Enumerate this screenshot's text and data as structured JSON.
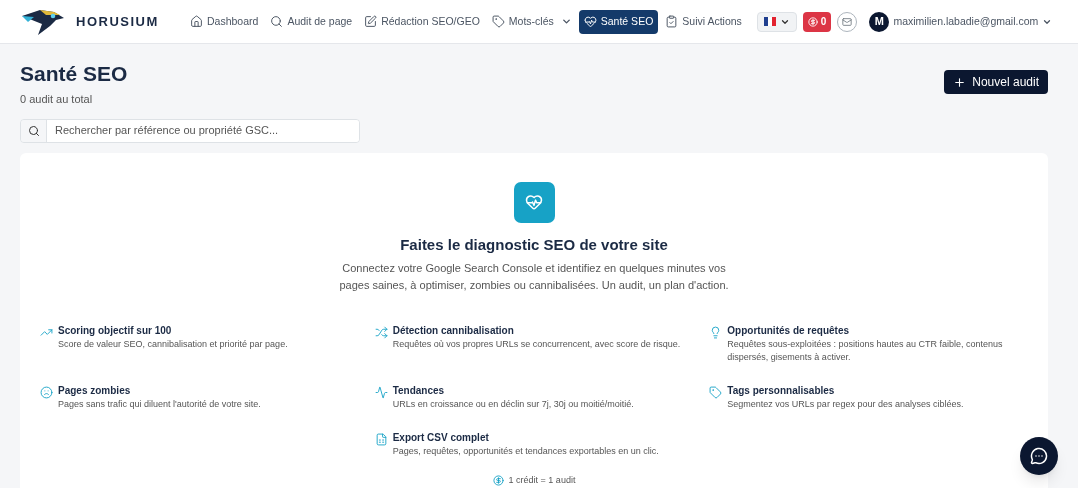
{
  "brand": {
    "name": "HORUSIUM"
  },
  "nav": [
    {
      "label": "Dashboard",
      "kind": "home",
      "selected": false,
      "dropdown": false
    },
    {
      "label": "Audit de page",
      "kind": "search",
      "selected": false,
      "dropdown": false
    },
    {
      "label": "Rédaction SEO/GEO",
      "kind": "edit",
      "selected": false,
      "dropdown": false
    },
    {
      "label": "Mots-clés",
      "kind": "tag",
      "selected": false,
      "dropdown": true
    },
    {
      "label": "Santé SEO",
      "kind": "heart",
      "selected": true,
      "dropdown": false
    },
    {
      "label": "Suivi Actions",
      "kind": "clipboard",
      "selected": false,
      "dropdown": false
    }
  ],
  "credits_badge": "0",
  "user": {
    "initial": "M",
    "email": "maximilien.labadie@gmail.com"
  },
  "page": {
    "title": "Santé SEO",
    "subtitle": "0 audit au total",
    "new_button": "Nouvel audit"
  },
  "search": {
    "placeholder": "Rechercher par référence ou propriété GSC..."
  },
  "empty_state": {
    "title": "Faites le diagnostic SEO de votre site",
    "text": "Connectez votre Google Search Console et identifiez en quelques minutes vos pages saines, à optimiser, zombies ou cannibalisées. Un audit, un plan d'action.",
    "footer": "1 crédit = 1 audit"
  },
  "features": [
    {
      "kind": "chart",
      "title": "Scoring objectif sur 100",
      "text": "Score de valeur SEO, cannibalisation et priorité par page."
    },
    {
      "kind": "shuffle",
      "title": "Détection cannibalisation",
      "text": "Requêtes où vos propres URLs se concurrencent, avec score de risque."
    },
    {
      "kind": "bulb",
      "title": "Opportunités de requêtes",
      "text": "Requêtes sous-exploitées : positions hautes au CTR faible, contenus dispersés, gisements à activer."
    },
    {
      "kind": "sad",
      "title": "Pages zombies",
      "text": "Pages sans trafic qui diluent l'autorité de votre site."
    },
    {
      "kind": "pulse",
      "title": "Tendances",
      "text": "URLs en croissance ou en déclin sur 7j, 30j ou moitié/moitié."
    },
    {
      "kind": "tag",
      "title": "Tags personnalisables",
      "text": "Segmentez vos URLs par regex pour des analyses ciblées."
    },
    {
      "kind": "csv",
      "title": "Export CSV complet",
      "text": "Pages, requêtes, opportunités et tendances exportables en un clic."
    }
  ]
}
